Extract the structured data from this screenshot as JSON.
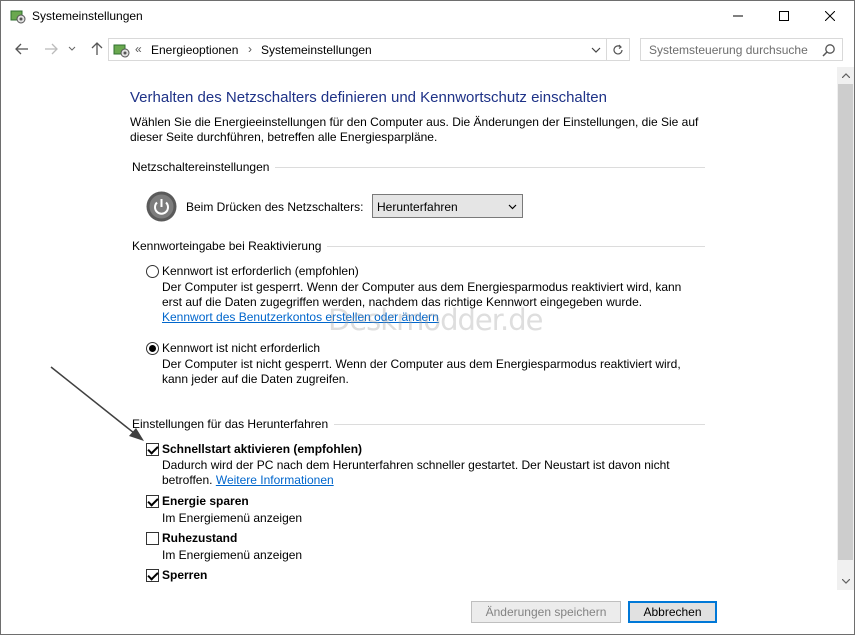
{
  "window": {
    "title": "Systemeinstellungen"
  },
  "nav": {
    "breadcrumbs": [
      "Energieoptionen",
      "Systemeinstellungen"
    ],
    "overflow_marker": "«",
    "search_placeholder": "Systemsteuerung durchsuchen"
  },
  "page": {
    "title": "Verhalten des Netzschalters definieren und Kennwortschutz einschalten",
    "intro": "Wählen Sie die Energieeinstellungen für den Computer aus. Die Änderungen der Einstellungen, die Sie auf dieser Seite durchführen, betreffen alle Energiesparpläne."
  },
  "power_section": {
    "heading": "Netzschaltereinstellungen",
    "label": "Beim Drücken des Netzschalters:",
    "selected": "Herunterfahren"
  },
  "password_section": {
    "heading": "Kennworteingabe bei Reaktivierung",
    "options": [
      {
        "label": "Kennwort ist erforderlich (empfohlen)",
        "desc": "Der Computer ist gesperrt. Wenn der Computer aus dem Energiesparmodus reaktiviert wird, kann erst auf die Daten zugegriffen werden, nachdem das richtige Kennwort eingegeben wurde.",
        "link": "Kennwort des Benutzerkontos erstellen oder ändern",
        "checked": false
      },
      {
        "label": "Kennwort ist nicht erforderlich",
        "desc": "Der Computer ist nicht gesperrt. Wenn der Computer aus dem Energiesparmodus reaktiviert wird, kann jeder auf die Daten zugreifen.",
        "checked": true
      }
    ]
  },
  "shutdown_section": {
    "heading": "Einstellungen für das Herunterfahren",
    "items": [
      {
        "label": "Schnellstart aktivieren (empfohlen)",
        "desc": "Dadurch wird der PC nach dem Herunterfahren schneller gestartet. Der Neustart ist davon nicht betroffen.",
        "link": "Weitere Informationen",
        "checked": true
      },
      {
        "label": "Energie sparen",
        "desc": "Im Energiemenü anzeigen",
        "checked": true
      },
      {
        "label": "Ruhezustand",
        "desc": "Im Energiemenü anzeigen",
        "checked": false
      },
      {
        "label": "Sperren",
        "checked": true
      }
    ]
  },
  "watermark": "Deskmodder.de",
  "buttons": {
    "save": "Änderungen speichern",
    "cancel": "Abbrechen"
  },
  "colors": {
    "title_blue": "#1e3287",
    "link_blue": "#0066cc"
  }
}
